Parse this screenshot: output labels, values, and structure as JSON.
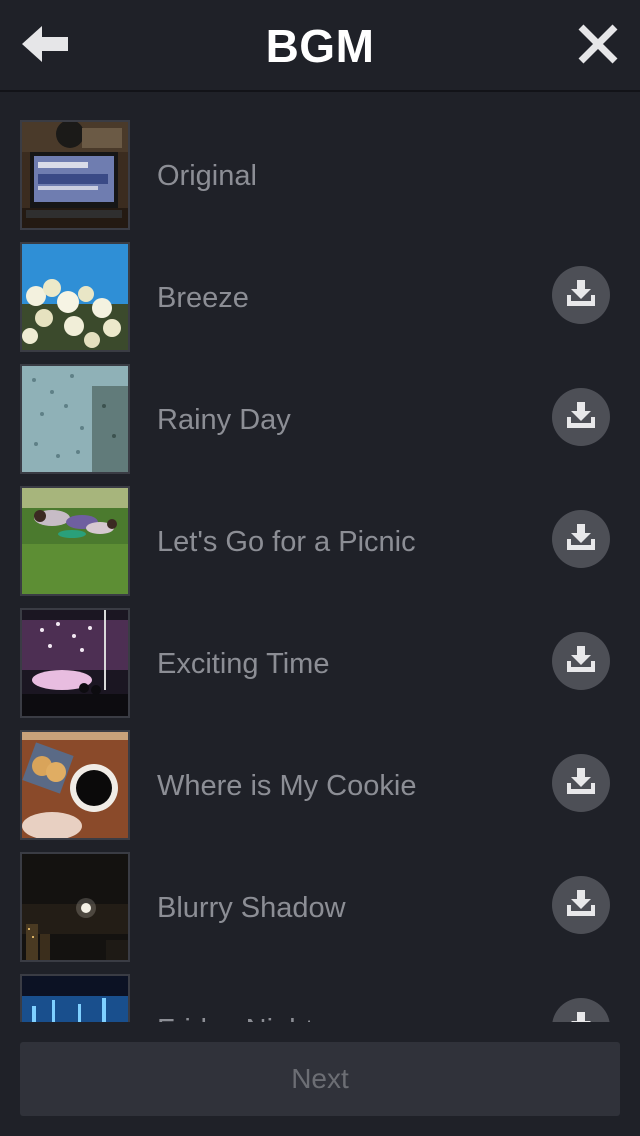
{
  "header": {
    "title": "BGM",
    "back_icon": "back-arrow-icon",
    "close_icon": "close-icon"
  },
  "tracks": [
    {
      "label": "Original",
      "downloadable": false,
      "thumb": "laptop-photo"
    },
    {
      "label": "Breeze",
      "downloadable": true,
      "thumb": "white-flowers-blue-sky-photo"
    },
    {
      "label": "Rainy Day",
      "downloadable": true,
      "thumb": "raindrops-window-photo"
    },
    {
      "label": "Let's Go for a Picnic",
      "downloadable": true,
      "thumb": "people-on-grass-photo"
    },
    {
      "label": "Exciting Time",
      "downloadable": true,
      "thumb": "concert-lights-photo"
    },
    {
      "label": "Where is My Cookie",
      "downloadable": true,
      "thumb": "coffee-and-cookies-photo"
    },
    {
      "label": "Blurry Shadow",
      "downloadable": true,
      "thumb": "night-moon-city-photo"
    },
    {
      "label": "Friday Night",
      "downloadable": true,
      "thumb": "stage-blue-lights-photo"
    }
  ],
  "footer": {
    "next_label": "Next"
  },
  "colors": {
    "background": "#1f2128",
    "label": "#8c8e95",
    "download_button": "#4d4f56",
    "next_button": "#30323a"
  }
}
